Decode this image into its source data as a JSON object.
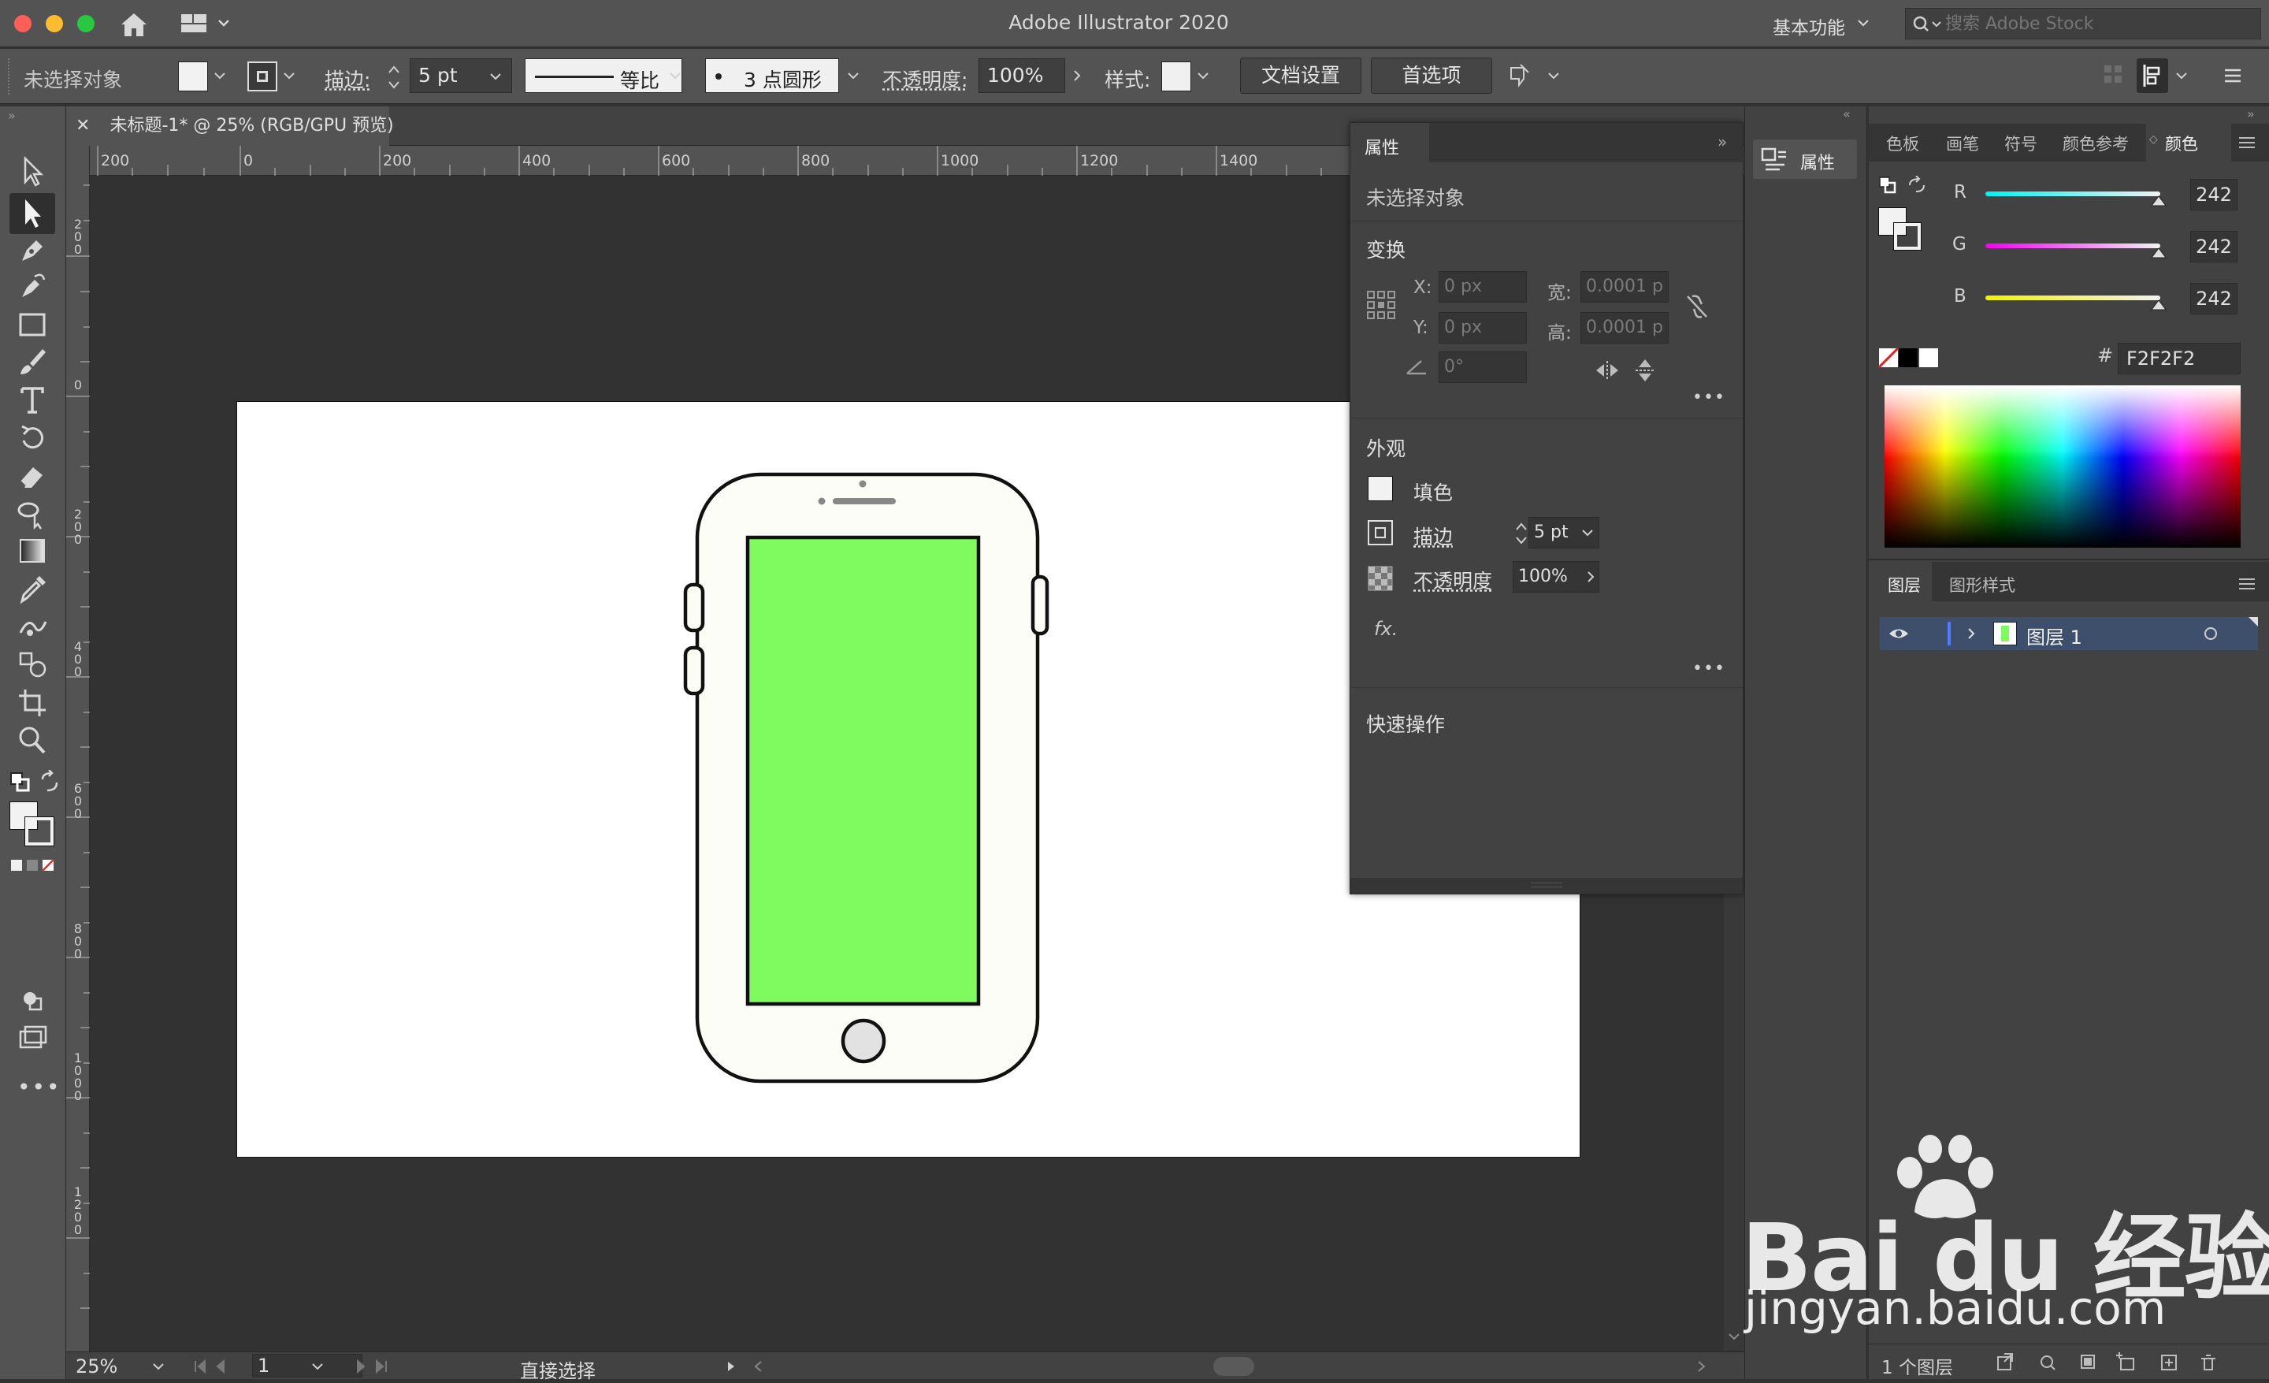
{
  "titlebar": {
    "app_title": "Adobe Illustrator 2020",
    "workspace": "基本功能",
    "stock_search_placeholder": "搜索 Adobe Stock"
  },
  "control_bar": {
    "selection": "未选择对象",
    "stroke_label": "描边:",
    "stroke_value": "5 pt",
    "stroke_profile": "等比",
    "brush": "3 点圆形",
    "opacity_label": "不透明度:",
    "opacity_value": "100%",
    "style_label": "样式:",
    "doc_setup": "文档设置",
    "preferences": "首选项"
  },
  "document": {
    "tab_title": "未标题-1* @ 25% (RGB/GPU 预览)"
  },
  "ruler": {
    "h_labels": [
      "200",
      "0",
      "200",
      "400",
      "600",
      "800",
      "1000",
      "1200",
      "1400"
    ],
    "v_labels": [
      "2",
      "0",
      "0",
      "2",
      "0",
      "0",
      "4",
      "0",
      "0",
      "6",
      "0",
      "0",
      "8",
      "0",
      "0",
      "1",
      "0",
      "0",
      "0",
      "1",
      "2",
      "0",
      "0"
    ]
  },
  "status_bar": {
    "zoom": "25%",
    "artboard": "1",
    "tool": "直接选择"
  },
  "properties": {
    "tab": "属性",
    "no_selection": "未选择对象",
    "transform": "变换",
    "x_label": "X:",
    "x_value": "0 px",
    "y_label": "Y:",
    "y_value": "0 px",
    "w_label": "宽:",
    "w_value": "0.0001 p",
    "h_label": "高:",
    "h_value": "0.0001 p",
    "angle_value": "0°",
    "appearance": "外观",
    "fill": "填色",
    "stroke": "描边",
    "stroke_value": "5 pt",
    "opacity": "不透明度",
    "opacity_value": "100%",
    "fx": "fx.",
    "quick_actions": "快速操作"
  },
  "dock": {
    "properties": "属性"
  },
  "color_panel": {
    "tabs": [
      "色板",
      "画笔",
      "符号",
      "颜色参考",
      "颜色"
    ],
    "r_label": "R",
    "r": "242",
    "g_label": "G",
    "g": "242",
    "b_label": "B",
    "b": "242",
    "hash": "#",
    "hex": "F2F2F2"
  },
  "layers_panel": {
    "tabs": [
      "图层",
      "图形样式"
    ],
    "layer_name": "图层 1",
    "count": "1 个图层"
  },
  "watermark": {
    "brand": "Bai du 经验",
    "url": "jingyan.baidu.com"
  },
  "colors": {
    "screen_green": "#7FFB5F",
    "ui_dark": "#323232",
    "panel": "#424242",
    "selection_blue": "#3d4f6a",
    "fill_white": "#F2F2F2"
  }
}
